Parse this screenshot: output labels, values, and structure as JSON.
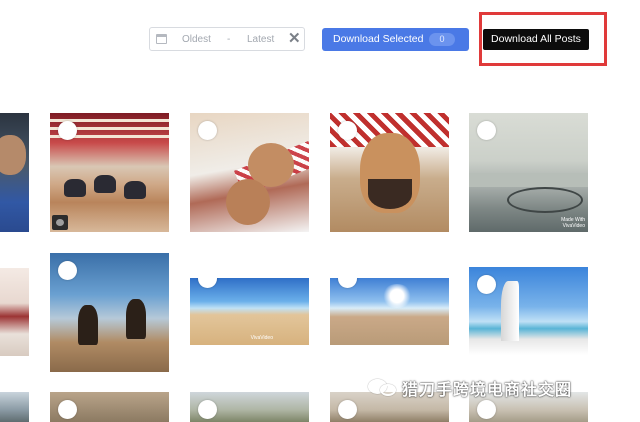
{
  "toolbar": {
    "date_range": {
      "from_placeholder": "Oldest",
      "separator": "-",
      "to_placeholder": "Latest",
      "clear_symbol": "✕",
      "calendar_icon": "calendar-icon"
    },
    "download_selected": {
      "label": "Download Selected",
      "count": "0",
      "color": "#4a79e6"
    },
    "download_all": {
      "label": "Download All Posts",
      "color": "#0c0c0c"
    },
    "highlight_color": "#e03a3a"
  },
  "posts": [
    {
      "id": "post-1",
      "caption": ""
    },
    {
      "id": "post-2",
      "caption": ""
    },
    {
      "id": "post-3",
      "caption": ""
    },
    {
      "id": "post-4",
      "caption": ""
    },
    {
      "id": "post-5",
      "caption": "Made With\nVivaVideo"
    },
    {
      "id": "post-6",
      "caption": ""
    },
    {
      "id": "post-7",
      "caption": ""
    },
    {
      "id": "post-8",
      "caption": "VivaVideo"
    },
    {
      "id": "post-9",
      "caption": ""
    },
    {
      "id": "post-10",
      "caption": ""
    },
    {
      "id": "post-11",
      "caption": ""
    },
    {
      "id": "post-12",
      "caption": ""
    },
    {
      "id": "post-13",
      "caption": ""
    },
    {
      "id": "post-14",
      "caption": ""
    },
    {
      "id": "post-15",
      "caption": ""
    }
  ],
  "watermark": {
    "text": "猎刀手跨境电商社交圈"
  }
}
